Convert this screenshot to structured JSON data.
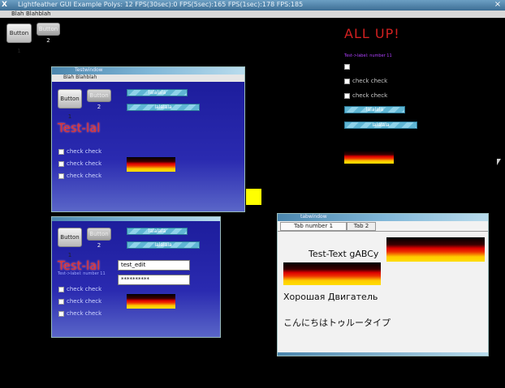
{
  "app": {
    "title": "Lightfeather GUI Example Polys: 12 FPS(30sec):0 FPS(5sec):165 FPS(1sec):178 FPS:185",
    "logo": "X",
    "close": "×",
    "menu": [
      "Blah",
      "Blahblah"
    ]
  },
  "desktop": {
    "button1": "Button 1",
    "button2": "Button 2",
    "heading": "ALL UP!",
    "label_small": "Test->label: number 11",
    "checks": [
      "",
      "check check",
      "check check"
    ],
    "bar1": "lalalala",
    "bar2": "lalalala"
  },
  "window1": {
    "title": "Testwindow",
    "menu": "Blah  Blahblah",
    "button1": "Button 1",
    "button2": "Button 2",
    "bar1": "lalalala",
    "bar2": "lalalala",
    "label": "Test-lal",
    "checks": [
      "check check",
      "check check",
      "check check"
    ]
  },
  "window2": {
    "button1": "Button 1",
    "button2": "Button 2",
    "bar1": "lalalala",
    "bar2": "lalalala",
    "label": "Test-lal",
    "label_small": "Test->label: number 11",
    "edit_value": "test_edit",
    "password_value": "**********",
    "checks": [
      "check check",
      "check check",
      "check check"
    ]
  },
  "tabwindow": {
    "title": "tabwindow",
    "tabs": [
      "Tab number 1",
      "Tab 2"
    ],
    "test_text": "Test-Text gABCy",
    "russian": "Хорошая Двигатель",
    "japanese": "こんにちはトゥルータイプ"
  },
  "colors": {
    "accent_yellow": "#ffff00",
    "heading_red": "#d22020",
    "window_blue": "#1d1d9c"
  }
}
